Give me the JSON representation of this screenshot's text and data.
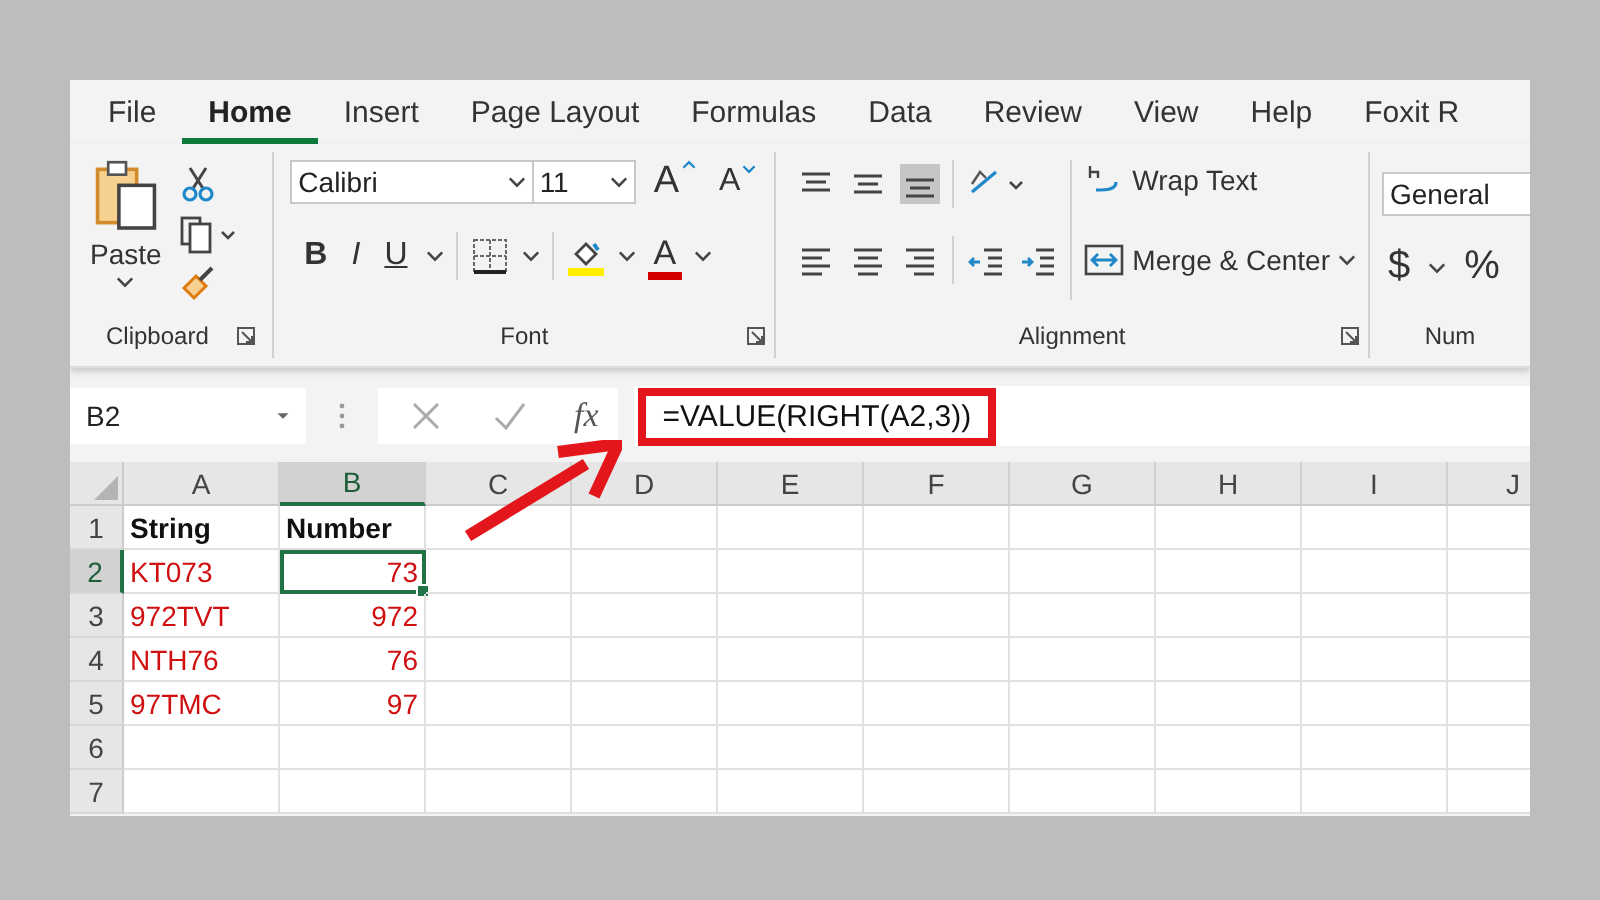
{
  "tabs": [
    {
      "label": "File",
      "selected": false
    },
    {
      "label": "Home",
      "selected": true
    },
    {
      "label": "Insert",
      "selected": false
    },
    {
      "label": "Page Layout",
      "selected": false
    },
    {
      "label": "Formulas",
      "selected": false
    },
    {
      "label": "Data",
      "selected": false
    },
    {
      "label": "Review",
      "selected": false
    },
    {
      "label": "View",
      "selected": false
    },
    {
      "label": "Help",
      "selected": false
    },
    {
      "label": "Foxit R",
      "selected": false
    }
  ],
  "ribbon": {
    "clipboard": {
      "paste": "Paste",
      "label": "Clipboard"
    },
    "font": {
      "family": "Calibri",
      "size": "11",
      "grow": "A",
      "shrink": "A",
      "bold": "B",
      "italic": "I",
      "underline": "U",
      "color_letter": "A",
      "label": "Font"
    },
    "alignment": {
      "wrap_text": "Wrap Text",
      "merge_center": "Merge & Center",
      "label": "Alignment"
    },
    "number": {
      "format": "General",
      "currency": "$",
      "percent": "%",
      "label": "Num"
    }
  },
  "formula_bar": {
    "name_box": "B2",
    "fx": "fx",
    "formula": "=VALUE(RIGHT(A2,3))",
    "highlighted": true
  },
  "sheet": {
    "columns": [
      {
        "label": "A",
        "selected": false
      },
      {
        "label": "B",
        "selected": true
      },
      {
        "label": "C",
        "selected": false
      },
      {
        "label": "D",
        "selected": false
      },
      {
        "label": "E",
        "selected": false
      },
      {
        "label": "F",
        "selected": false
      },
      {
        "label": "G",
        "selected": false
      },
      {
        "label": "H",
        "selected": false
      },
      {
        "label": "I",
        "selected": false
      },
      {
        "label": "J",
        "selected": false
      }
    ],
    "rows": [
      {
        "label": "1",
        "selected": false,
        "cells": [
          {
            "text": "String",
            "kind": "header",
            "selected": false
          },
          {
            "text": "Number",
            "kind": "header",
            "selected": false
          }
        ]
      },
      {
        "label": "2",
        "selected": true,
        "cells": [
          {
            "text": "KT073",
            "kind": "text",
            "selected": false
          },
          {
            "text": "73",
            "kind": "number",
            "selected": true
          }
        ]
      },
      {
        "label": "3",
        "selected": false,
        "cells": [
          {
            "text": "972TVT",
            "kind": "text",
            "selected": false
          },
          {
            "text": "972",
            "kind": "number",
            "selected": false
          }
        ]
      },
      {
        "label": "4",
        "selected": false,
        "cells": [
          {
            "text": "NTH76",
            "kind": "text",
            "selected": false
          },
          {
            "text": "76",
            "kind": "number",
            "selected": false
          }
        ]
      },
      {
        "label": "5",
        "selected": false,
        "cells": [
          {
            "text": "97TMC",
            "kind": "text",
            "selected": false
          },
          {
            "text": "97",
            "kind": "number",
            "selected": false
          }
        ]
      },
      {
        "label": "6",
        "selected": false,
        "cells": []
      },
      {
        "label": "7",
        "selected": false,
        "cells": []
      }
    ]
  }
}
